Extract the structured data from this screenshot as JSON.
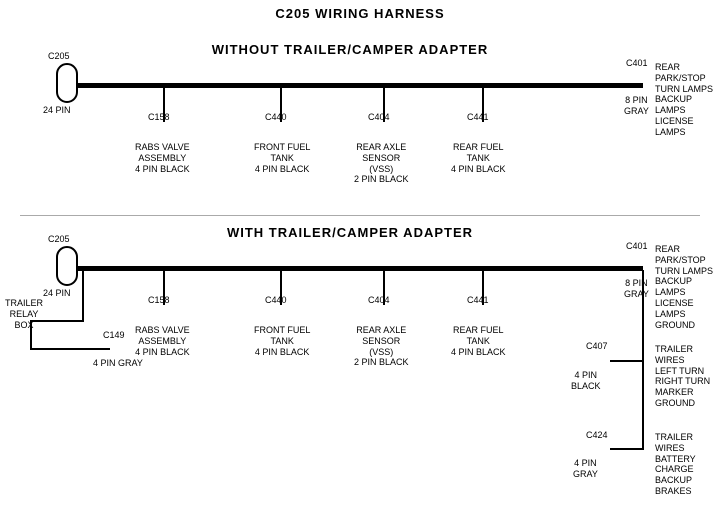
{
  "title": "C205 WIRING HARNESS",
  "section1": {
    "label": "WITHOUT  TRAILER/CAMPER  ADAPTER",
    "left_connector": {
      "id": "C205",
      "sub": "24 PIN"
    },
    "right_connector": {
      "id": "C401",
      "sub": "8 PIN\nGRAY",
      "label": "REAR PARK/STOP\nTURN LAMPS\nBACKUP LAMPS\nLICENSE LAMPS"
    },
    "connectors": [
      {
        "id": "C158",
        "label": "RABS VALVE\nASSEMBLY\n4 PIN BLACK"
      },
      {
        "id": "C440",
        "label": "FRONT FUEL\nTANK\n4 PIN BLACK"
      },
      {
        "id": "C404",
        "label": "REAR AXLE\nSENSOR\n(VSS)\n2 PIN BLACK"
      },
      {
        "id": "C441",
        "label": "REAR FUEL\nTANK\n4 PIN BLACK"
      }
    ]
  },
  "section2": {
    "label": "WITH  TRAILER/CAMPER  ADAPTER",
    "left_connector": {
      "id": "C205",
      "sub": "24 PIN"
    },
    "trailer_relay": {
      "label": "TRAILER\nRELAY\nBOX"
    },
    "c149": {
      "id": "C149",
      "sub": "4 PIN GRAY"
    },
    "right_connector": {
      "id": "C401",
      "sub": "8 PIN\nGRAY",
      "label": "REAR PARK/STOP\nTURN LAMPS\nBACKUP LAMPS\nLICENSE LAMPS\nGROUND"
    },
    "c407": {
      "id": "C407",
      "sub": "4 PIN\nBLACK",
      "label": "TRAILER WIRES\nLEFT TURN\nRIGHT TURN\nMARKER\nGROUND"
    },
    "c424": {
      "id": "C424",
      "sub": "4 PIN\nGRAY",
      "label": "TRAILER WIRES\nBATTERY CHARGE\nBACKUP\nBRAKES"
    },
    "connectors": [
      {
        "id": "C158",
        "label": "RABS VALVE\nASSEMBLY\n4 PIN BLACK"
      },
      {
        "id": "C440",
        "label": "FRONT FUEL\nTANK\n4 PIN BLACK"
      },
      {
        "id": "C404",
        "label": "REAR AXLE\nSENSOR\n(VSS)\n2 PIN BLACK"
      },
      {
        "id": "C441",
        "label": "REAR FUEL\nTANK\n4 PIN BLACK"
      }
    ]
  }
}
